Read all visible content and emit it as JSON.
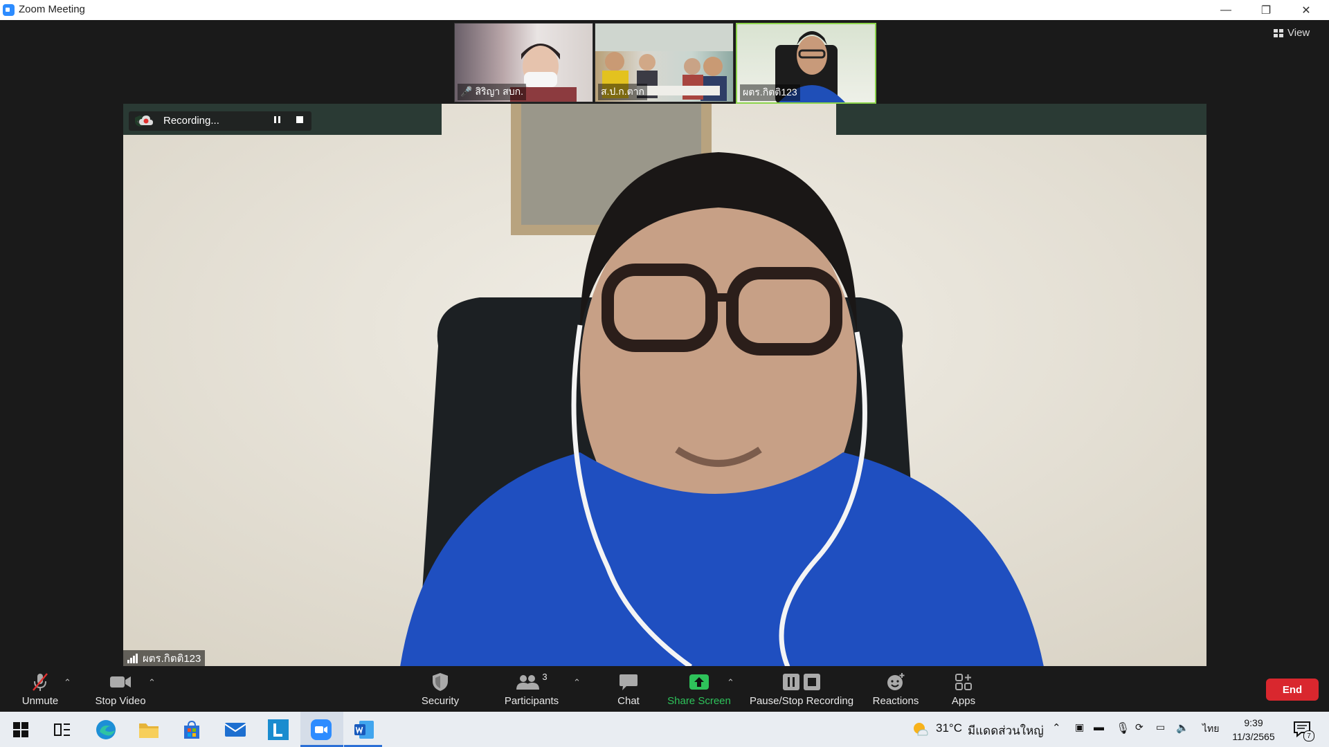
{
  "window": {
    "title": "Zoom Meeting",
    "minimize": "—",
    "restore": "❐",
    "close": "✕"
  },
  "view_button": {
    "label": "View"
  },
  "thumbnails": [
    {
      "name": "สิริญา สบก."
    },
    {
      "name": "ส.ป.ก.ตาก"
    },
    {
      "name": "ผตร.กิตติ123"
    }
  ],
  "recording": {
    "label": "Recording..."
  },
  "active_speaker": {
    "name": "ผตร.กิตติ123"
  },
  "toolbar": {
    "unmute": "Unmute",
    "stop_video": "Stop Video",
    "security": "Security",
    "participants": "Participants",
    "participants_count": "3",
    "chat": "Chat",
    "share_screen": "Share Screen",
    "pause_stop_recording": "Pause/Stop Recording",
    "reactions": "Reactions",
    "apps": "Apps",
    "end": "End"
  },
  "taskbar": {
    "weather": "31°C",
    "weather_text": "มีแดดส่วนใหญ่",
    "language": "ไทย",
    "time": "9:39",
    "date": "11/3/2565",
    "notification_count": "7"
  },
  "colors": {
    "share_green": "#2ec25a",
    "end_red": "#d9272e",
    "active_border": "#8bd34a",
    "zoom_blue": "#2d8cff"
  }
}
